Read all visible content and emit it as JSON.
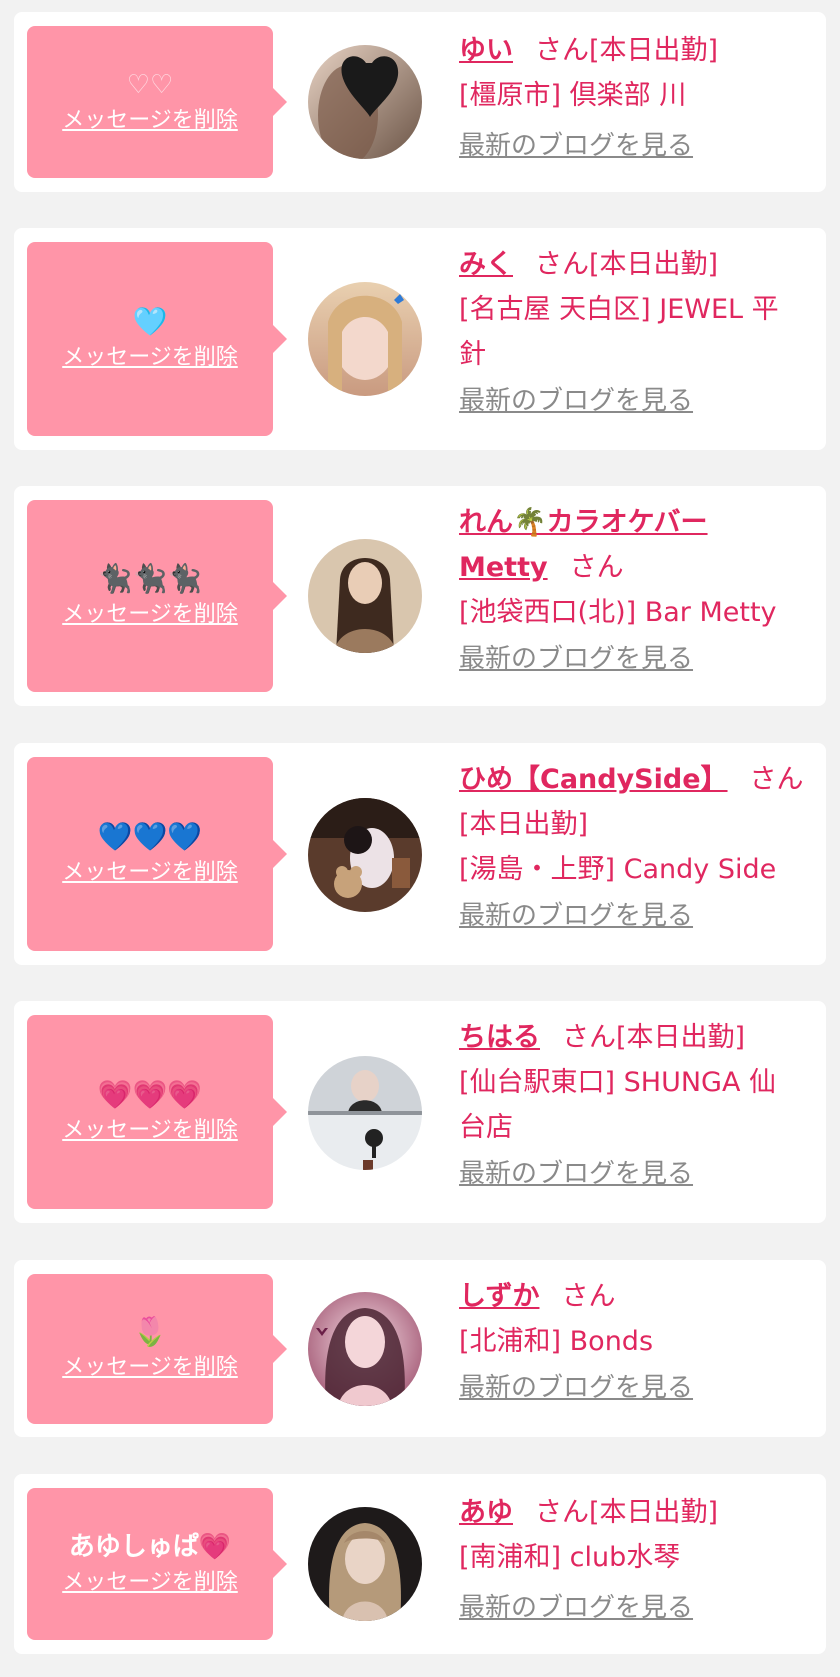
{
  "common": {
    "delete_label": "メッセージを削除",
    "blog_label": "最新のブログを見る",
    "san": "さん"
  },
  "colors": {
    "bubble": "#ff95a8",
    "name": "#e0275f",
    "link_gray": "#8a8a8a",
    "background": "#f2f2f2"
  },
  "items": [
    {
      "message": "♡♡",
      "name": "ゆい",
      "status": "[本日出勤]",
      "shop_line1": "[橿原市] 倶楽部 川",
      "shop_line2": ""
    },
    {
      "message": "🩵",
      "name": "みく",
      "status": "[本日出勤]",
      "shop_line1": "[名古屋 天白区] JEWEL 平",
      "shop_line2": "針"
    },
    {
      "message": "🐈‍⬛🐈‍⬛🐈‍⬛",
      "name": "れん🌴カラオケバー",
      "name_line2": "Metty",
      "status": "",
      "shop_line1": "[池袋西口(北)] Bar Metty",
      "shop_line2": ""
    },
    {
      "message": "💙💙💙",
      "name": "ひめ【CandySide】",
      "status": "[本日出勤]",
      "shop_line1": "[湯島・上野] Candy Side",
      "shop_line2": ""
    },
    {
      "message": "💗💗💗",
      "name": "ちはる",
      "status": "[本日出勤]",
      "shop_line1": "[仙台駅東口] SHUNGA 仙",
      "shop_line2": "台店"
    },
    {
      "message": "🌷",
      "name": "しずか",
      "status": "",
      "shop_line1": "[北浦和] Bonds",
      "shop_line2": ""
    },
    {
      "message": "あゆしゅぱ💗",
      "name": "あゆ",
      "status": "[本日出勤]",
      "shop_line1": "[南浦和] club水琴",
      "shop_line2": ""
    }
  ]
}
